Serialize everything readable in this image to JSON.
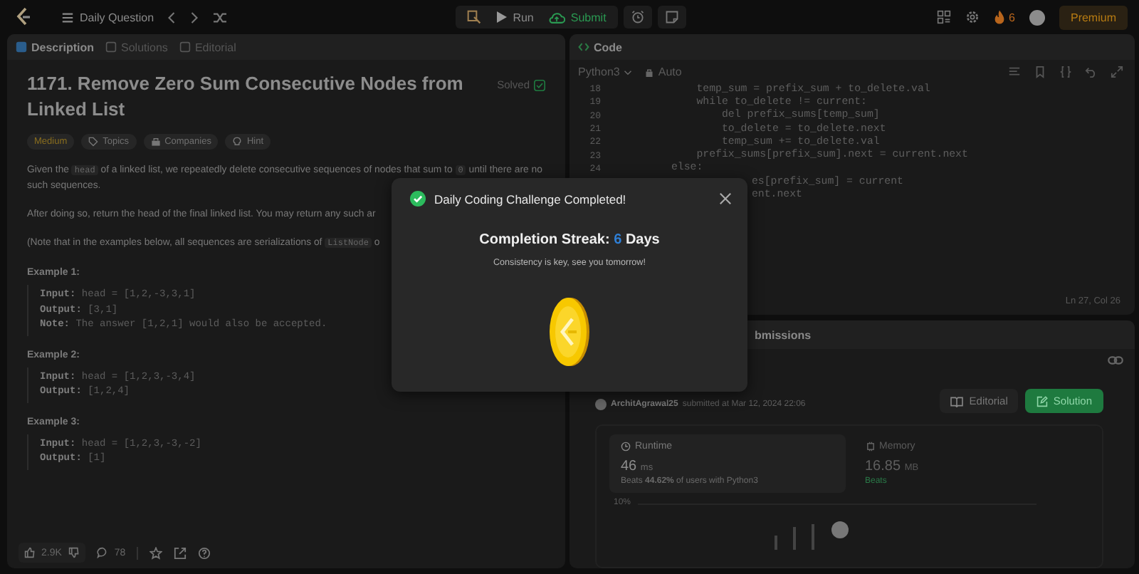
{
  "top_bar": {
    "nav_title": "Daily Question",
    "run": "Run",
    "submit": "Submit",
    "streak": "6",
    "premium": "Premium"
  },
  "description_panel": {
    "tabs": [
      {
        "label": "Description",
        "selected": true
      },
      {
        "label": "Solutions",
        "selected": false
      },
      {
        "label": "Editorial",
        "selected": false
      }
    ],
    "title": "1171. Remove Zero Sum Consecutive Nodes from Linked List",
    "status": "Solved",
    "tags": [
      {
        "label": "Medium",
        "kind": "difficulty"
      },
      {
        "label": "Topics",
        "kind": "topics"
      },
      {
        "label": "Companies",
        "kind": "companies"
      },
      {
        "label": "Hint",
        "kind": "hint"
      }
    ],
    "paragraphs": [
      [
        {
          "text": "Given the ",
          "code": false
        },
        {
          "text": "head",
          "code": true
        },
        {
          "text": " of a linked list, we repeatedly delete consecutive sequences of nodes that sum to ",
          "code": false
        },
        {
          "text": "0",
          "code": true
        },
        {
          "text": " until there are no such sequences.",
          "code": false
        }
      ],
      [
        {
          "text": "After doing so, return the head of the final linked list.  You may return any such ar",
          "code": false
        }
      ],
      [
        {
          "text": "(Note that in the examples below, all sequences are serializations of ",
          "code": false
        },
        {
          "text": "ListNode",
          "code": true
        },
        {
          "text": " o",
          "code": false
        }
      ]
    ],
    "examples": [
      {
        "heading": "Example 1:",
        "lines": [
          {
            "label": "Input:",
            "value": "head = [1,2,-3,3,1]"
          },
          {
            "label": "Output:",
            "value": "[3,1]"
          },
          {
            "label": "Note:",
            "value": "The answer [1,2,1] would also be accepted."
          }
        ]
      },
      {
        "heading": "Example 2:",
        "lines": [
          {
            "label": "Input:",
            "value": "head = [1,2,3,-3,4]"
          },
          {
            "label": "Output:",
            "value": "[1,2,4]"
          }
        ]
      },
      {
        "heading": "Example 3:",
        "lines": [
          {
            "label": "Input:",
            "value": "head = [1,2,3,-3,-2]"
          },
          {
            "label": "Output:",
            "value": "[1]"
          }
        ]
      }
    ],
    "footer": {
      "likes": "2.9K",
      "comments": "78"
    }
  },
  "code_panel": {
    "tab": "Code",
    "language": "Python3",
    "mode": "Auto",
    "cursor": "Ln 27, Col 26",
    "lines": [
      {
        "kind": "full",
        "number": "18",
        "text": "            temp_sum = prefix_sum + to_delete.val"
      },
      {
        "kind": "full",
        "number": "19",
        "text": "            while to_delete != current:"
      },
      {
        "kind": "full",
        "number": "20",
        "text": "                del prefix_sums[temp_sum]"
      },
      {
        "kind": "full",
        "number": "21",
        "text": "                to_delete = to_delete.next"
      },
      {
        "kind": "full",
        "number": "22",
        "text": "                temp_sum += to_delete.val"
      },
      {
        "kind": "full",
        "number": "23",
        "text": "            prefix_sums[prefix_sum].next = current.next"
      },
      {
        "kind": "full",
        "number": "24",
        "text": "        else:"
      },
      {
        "kind": "clipped",
        "text": "es[prefix_sum] = current"
      },
      {
        "kind": "clipped",
        "text": "ent.next"
      }
    ]
  },
  "submission_panel": {
    "tab": "bmissions",
    "author": "ArchitAgrawal25",
    "submitted": "submitted at Mar 12, 2024 22:06",
    "editorial": "Editorial",
    "solution": "Solution",
    "runtime": {
      "label": "Runtime",
      "value": "46",
      "unit": "ms",
      "beats": "Beats **44.62%** of users with Python3"
    },
    "memory": {
      "label": "Memory",
      "value": "16.85",
      "unit": "MB",
      "beats": "Beats"
    },
    "chart_tick": "10%"
  },
  "modal": {
    "title": "Daily Coding Challenge Completed!",
    "streak_label": "Completion Streak:",
    "streak_value": "6",
    "streak_unit": "Days",
    "message": "Consistency is key, see you tomorrow!"
  }
}
